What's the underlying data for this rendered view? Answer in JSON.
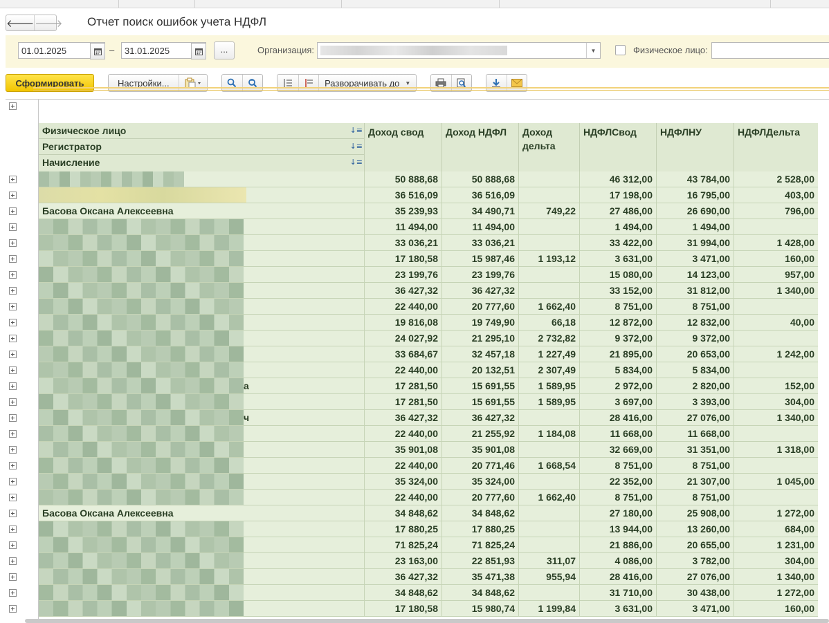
{
  "window": {
    "title": "Отчет поиск ошибок учета НДФЛ"
  },
  "filters": {
    "date_from": "01.01.2025",
    "date_to": "31.01.2025",
    "dash": "–",
    "dots_label": "...",
    "org_label": "Организация:",
    "person_label": "Физическое лицо:",
    "person_checked": false
  },
  "toolbar": {
    "generate_label": "Сформировать",
    "settings_label": "Настройки...",
    "expand_to_label": "Разворачивать до"
  },
  "icons": {
    "back": "arrow-left-icon",
    "forward": "arrow-right-icon",
    "calendar": "calendar-icon",
    "variants": "report-variants-icon",
    "find": "search-icon",
    "find_next": "search-next-icon",
    "collapse_groups": "collapse-groups-icon",
    "expand_groups": "expand-groups-icon",
    "print": "print-icon",
    "preview": "print-preview-icon",
    "save": "download-icon",
    "mail": "mail-icon",
    "sort": "sort-icon",
    "expand": "plus-box-icon"
  },
  "colors": {
    "accent": "#f7d117",
    "filter_bg": "#fbf7dd",
    "row_bg": "#e6efdb",
    "header_bg": "#dfe9d2"
  },
  "table": {
    "group_headers": [
      "Физическое лицо",
      "Регистратор",
      "Начисление"
    ],
    "columns": [
      "Доход свод",
      "Доход НДФЛ",
      "Доход дельта",
      "НДФЛСвод",
      "НДФЛНУ",
      "НДФЛДельта"
    ],
    "rows": [
      {
        "name": "",
        "values": [
          "50 888,68",
          "50 888,68",
          "",
          "46 312,00",
          "43 784,00",
          "2 528,00"
        ]
      },
      {
        "name": "",
        "values": [
          "36 516,09",
          "36 516,09",
          "",
          "17 198,00",
          "16 795,00",
          "403,00"
        ]
      },
      {
        "name": "Басова Оксана Алексеевна",
        "values": [
          "35 239,93",
          "34 490,71",
          "749,22",
          "27 486,00",
          "26 690,00",
          "796,00"
        ]
      },
      {
        "name": "",
        "values": [
          "11 494,00",
          "11 494,00",
          "",
          "1 494,00",
          "1 494,00",
          ""
        ]
      },
      {
        "name": "",
        "values": [
          "33 036,21",
          "33 036,21",
          "",
          "33 422,00",
          "31 994,00",
          "1 428,00"
        ]
      },
      {
        "name": "",
        "values": [
          "17 180,58",
          "15 987,46",
          "1 193,12",
          "3 631,00",
          "3 471,00",
          "160,00"
        ]
      },
      {
        "name": "",
        "values": [
          "23 199,76",
          "23 199,76",
          "",
          "15 080,00",
          "14 123,00",
          "957,00"
        ]
      },
      {
        "name": "",
        "values": [
          "36 427,32",
          "36 427,32",
          "",
          "33 152,00",
          "31 812,00",
          "1 340,00"
        ]
      },
      {
        "name": "",
        "values": [
          "22 440,00",
          "20 777,60",
          "1 662,40",
          "8 751,00",
          "8 751,00",
          ""
        ]
      },
      {
        "name": "",
        "values": [
          "19 816,08",
          "19 749,90",
          "66,18",
          "12 872,00",
          "12 832,00",
          "40,00"
        ]
      },
      {
        "name": "",
        "values": [
          "24 027,92",
          "21 295,10",
          "2 732,82",
          "9 372,00",
          "9 372,00",
          ""
        ]
      },
      {
        "name": "",
        "values": [
          "33 684,67",
          "32 457,18",
          "1 227,49",
          "21 895,00",
          "20 653,00",
          "1 242,00"
        ]
      },
      {
        "name": "",
        "values": [
          "22 440,00",
          "20 132,51",
          "2 307,49",
          "5 834,00",
          "5 834,00",
          ""
        ]
      },
      {
        "name": "а",
        "values": [
          "17 281,50",
          "15 691,55",
          "1 589,95",
          "2 972,00",
          "2 820,00",
          "152,00"
        ]
      },
      {
        "name": "",
        "values": [
          "17 281,50",
          "15 691,55",
          "1 589,95",
          "3 697,00",
          "3 393,00",
          "304,00"
        ]
      },
      {
        "name": "ч",
        "values": [
          "36 427,32",
          "36 427,32",
          "",
          "28 416,00",
          "27 076,00",
          "1 340,00"
        ]
      },
      {
        "name": "",
        "values": [
          "22 440,00",
          "21 255,92",
          "1 184,08",
          "11 668,00",
          "11 668,00",
          ""
        ]
      },
      {
        "name": "",
        "values": [
          "35 901,08",
          "35 901,08",
          "",
          "32 669,00",
          "31 351,00",
          "1 318,00"
        ]
      },
      {
        "name": "",
        "values": [
          "22 440,00",
          "20 771,46",
          "1 668,54",
          "8 751,00",
          "8 751,00",
          ""
        ]
      },
      {
        "name": "",
        "values": [
          "35 324,00",
          "35 324,00",
          "",
          "22 352,00",
          "21 307,00",
          "1 045,00"
        ]
      },
      {
        "name": "",
        "values": [
          "22 440,00",
          "20 777,60",
          "1 662,40",
          "8 751,00",
          "8 751,00",
          ""
        ]
      },
      {
        "name": "Басова Оксана Алексеевна",
        "values": [
          "34 848,62",
          "34 848,62",
          "",
          "27 180,00",
          "25 908,00",
          "1 272,00"
        ]
      },
      {
        "name": "",
        "values": [
          "17 880,25",
          "17 880,25",
          "",
          "13 944,00",
          "13 260,00",
          "684,00"
        ]
      },
      {
        "name": "",
        "values": [
          "71 825,24",
          "71 825,24",
          "",
          "21 886,00",
          "20 655,00",
          "1 231,00"
        ]
      },
      {
        "name": "",
        "values": [
          "23 163,00",
          "22 851,93",
          "311,07",
          "4 086,00",
          "3 782,00",
          "304,00"
        ]
      },
      {
        "name": "",
        "values": [
          "36 427,32",
          "35 471,38",
          "955,94",
          "28 416,00",
          "27 076,00",
          "1 340,00"
        ]
      },
      {
        "name": "",
        "values": [
          "34 848,62",
          "34 848,62",
          "",
          "31 710,00",
          "30 438,00",
          "1 272,00"
        ]
      },
      {
        "name": "",
        "values": [
          "17 180,58",
          "15 980,74",
          "1 199,84",
          "3 631,00",
          "3 471,00",
          "160,00"
        ]
      }
    ]
  }
}
